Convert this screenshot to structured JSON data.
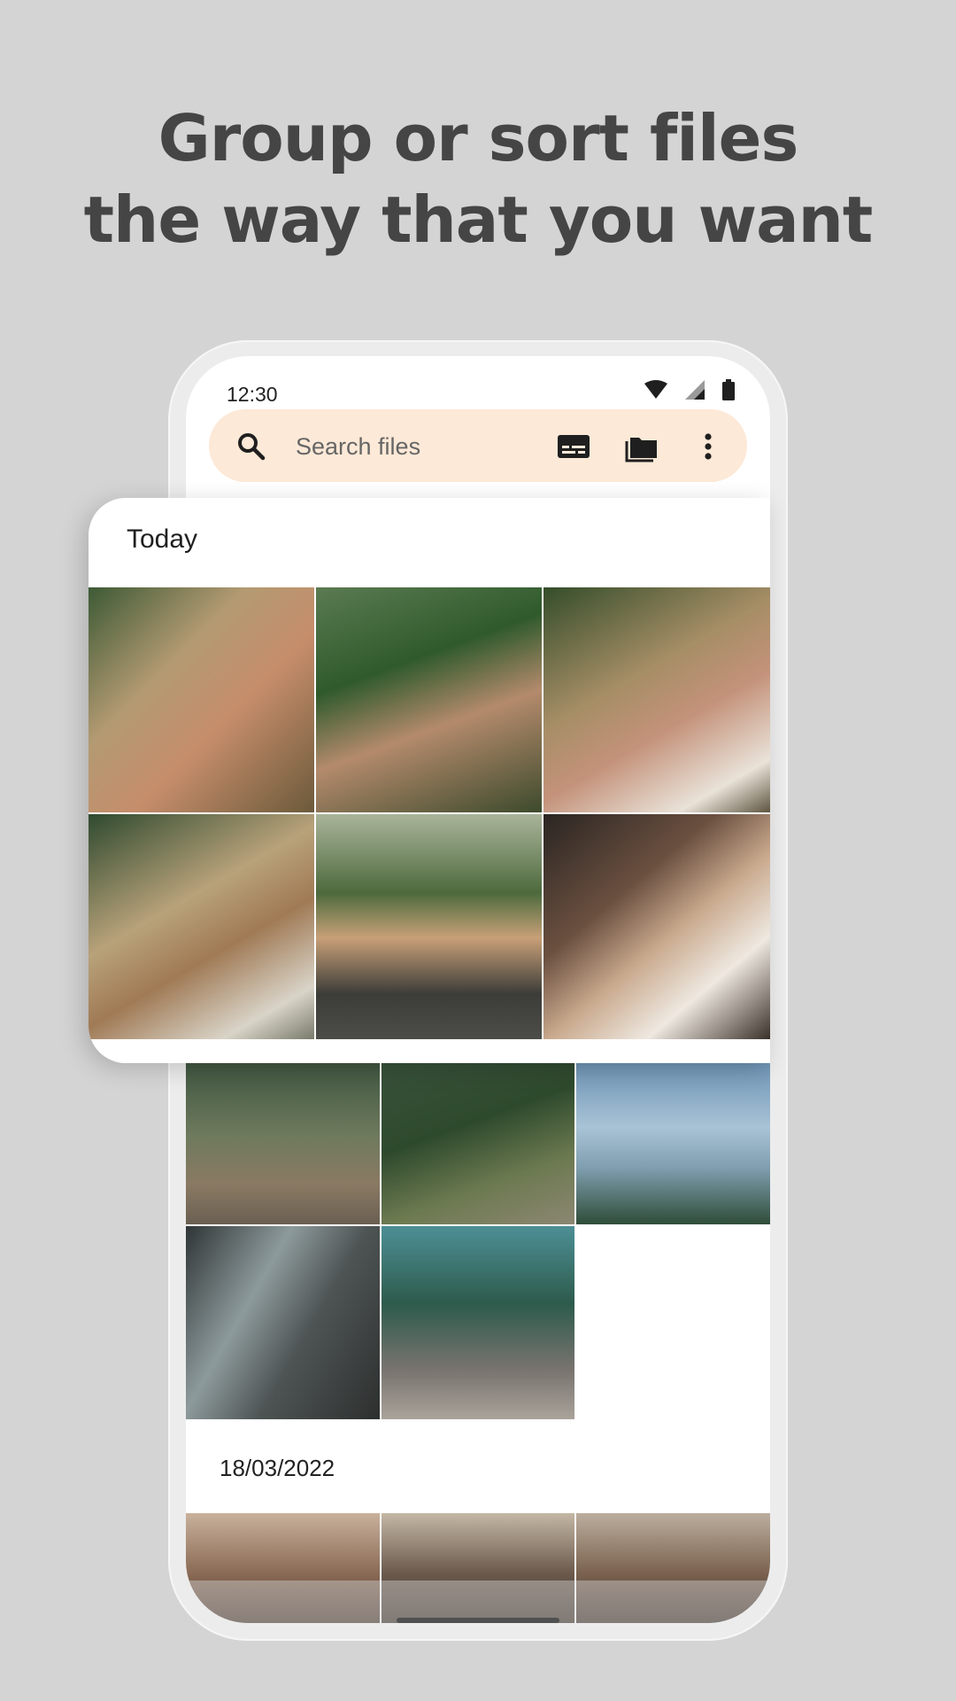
{
  "headline": {
    "line1": "Group or sort files",
    "line2": "the way that you want"
  },
  "status_bar": {
    "time": "12:30",
    "icons": [
      "wifi-icon",
      "cellular-signal-icon",
      "battery-icon"
    ]
  },
  "search": {
    "placeholder": "Search files",
    "icons": [
      "search-icon",
      "subtitles-icon",
      "folder-icon",
      "more-vert-icon"
    ]
  },
  "sections": {
    "today": "Today",
    "date2": "18/03/2022"
  },
  "colors": {
    "background": "#d4d4d4",
    "headline": "#454545",
    "search_bar": "#fde9d7"
  }
}
